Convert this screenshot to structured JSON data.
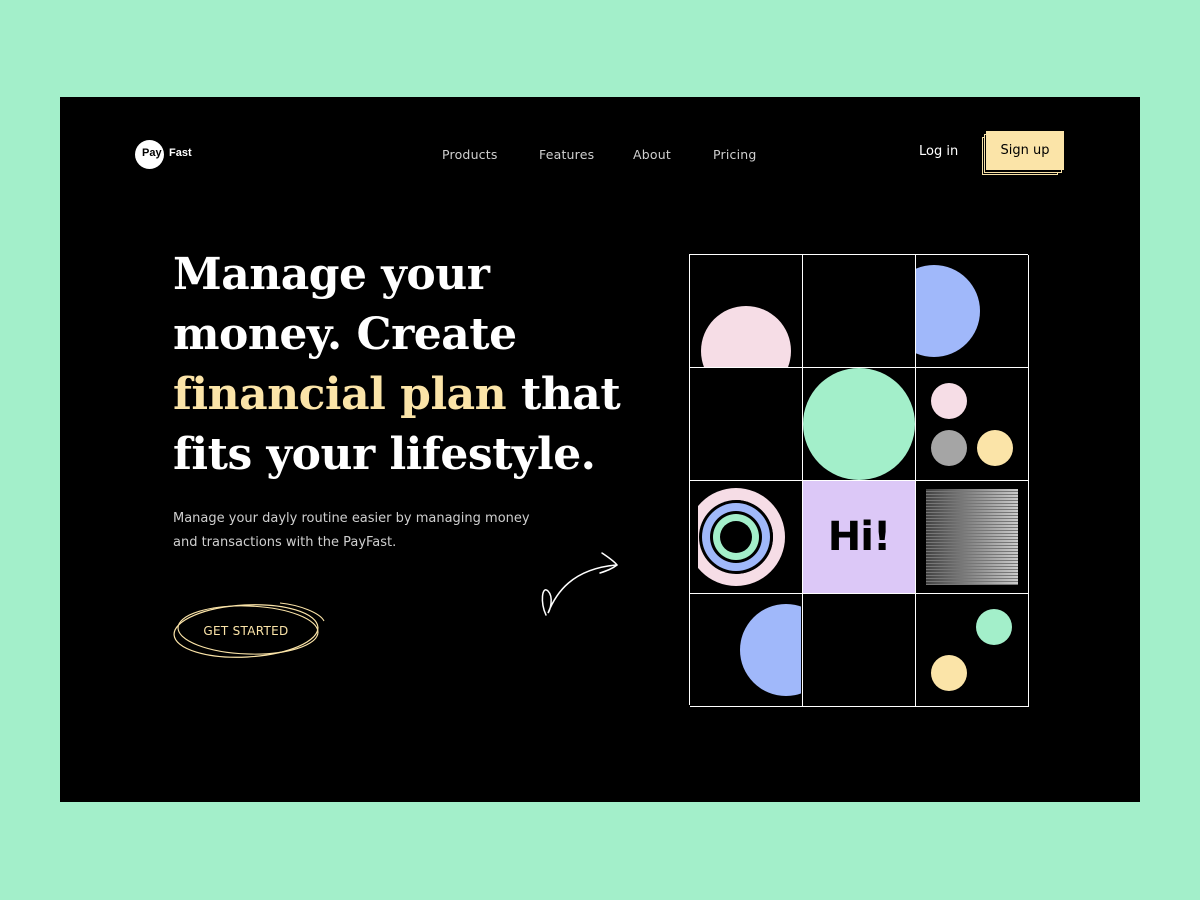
{
  "brand": {
    "logo_pay": "Pay",
    "logo_fast": "Fast"
  },
  "nav": {
    "items": [
      {
        "label": "Products"
      },
      {
        "label": "Features"
      },
      {
        "label": "About"
      },
      {
        "label": "Pricing"
      }
    ],
    "login_label": "Log in",
    "signup_label": "Sign up"
  },
  "hero": {
    "headline_line1": "Manage your",
    "headline_line2": "money. Create",
    "headline_highlight": "financial plan",
    "headline_line3_rest": " that",
    "headline_line4": "fits your lifestyle.",
    "subtext": "Manage your dayly routine easier by managing money and transactions with the  PayFast.",
    "cta_label": "GET STARTED"
  },
  "illustration": {
    "hi_text": "Hi!"
  },
  "colors": {
    "page_bg": "#a3efca",
    "frame_bg": "#000000",
    "accent_yellow": "#fbe4a8",
    "pink": "#f6dde6",
    "blue": "#a0b8fa",
    "mint": "#a3efca",
    "lavender": "#dcc8f7",
    "grey": "#a5a5a5"
  }
}
